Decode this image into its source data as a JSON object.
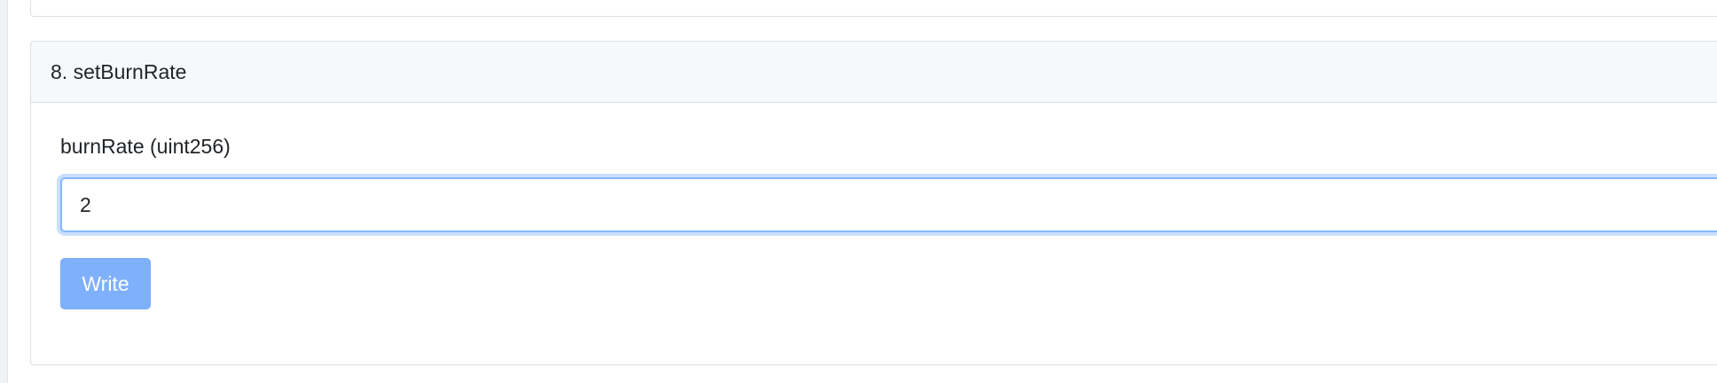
{
  "function_card": {
    "title": "8. setBurnRate",
    "input": {
      "label": "burnRate (uint256)",
      "value": "2",
      "placeholder": ""
    },
    "write_label": "Write"
  },
  "colors": {
    "primary_disabled": "#7fb0fb",
    "focus_border": "#86b7fe",
    "header_bg": "#f7f8fa",
    "border": "#dcdfe3"
  }
}
